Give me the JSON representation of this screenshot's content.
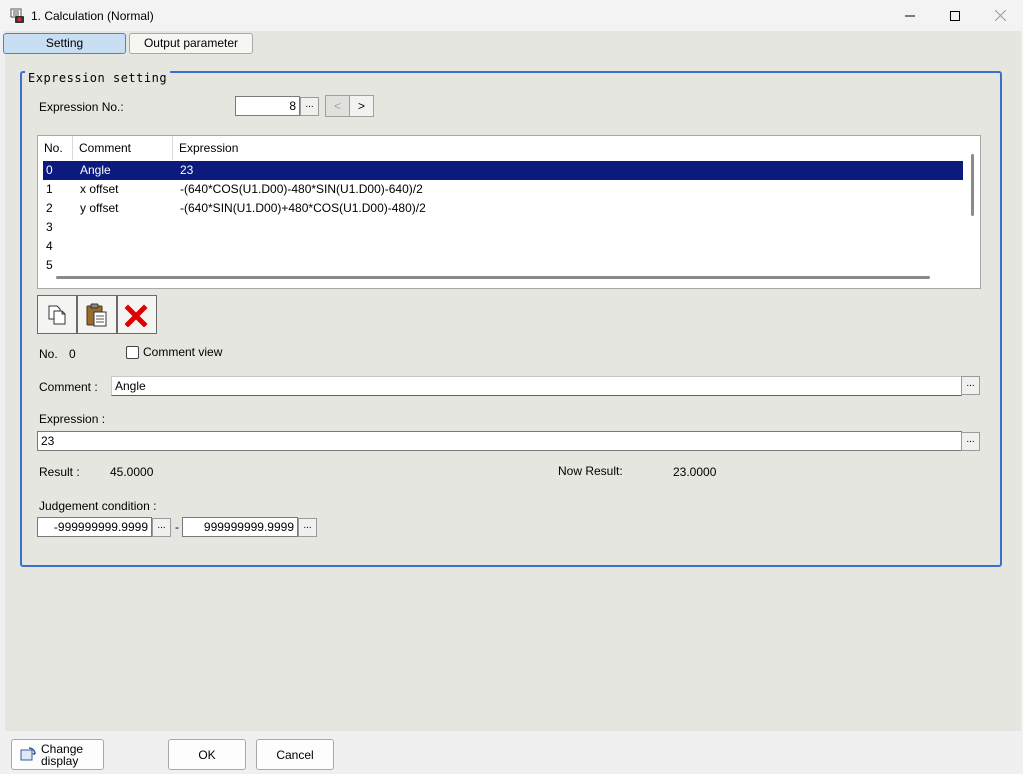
{
  "window": {
    "title": "1. Calculation (Normal)",
    "icon": "calculation-app-icon"
  },
  "tabs": [
    {
      "label": "Setting",
      "active": true
    },
    {
      "label": "Output parameter",
      "active": false
    }
  ],
  "group": {
    "legend": "Expression setting"
  },
  "expression_no": {
    "label": "Expression No.:",
    "value": "8",
    "ellipsis": "...",
    "prev": "<",
    "next": ">"
  },
  "table": {
    "headers": [
      "No.",
      "Comment",
      "Expression"
    ],
    "rows": [
      {
        "no": "0",
        "comment": "Angle",
        "expression": "23",
        "selected": true
      },
      {
        "no": "1",
        "comment": "x offset",
        "expression": "-(640*COS(U1.D00)-480*SIN(U1.D00)-640)/2"
      },
      {
        "no": "2",
        "comment": "y offset",
        "expression": "-(640*SIN(U1.D00)+480*COS(U1.D00)-480)/2"
      },
      {
        "no": "3",
        "comment": "",
        "expression": ""
      },
      {
        "no": "4",
        "comment": "",
        "expression": ""
      },
      {
        "no": "5",
        "comment": "",
        "expression": ""
      }
    ]
  },
  "toolbar": {
    "copy_icon": "copy-icon",
    "paste_icon": "paste-icon",
    "delete_icon": "delete-icon",
    "delete_color": "#e00000"
  },
  "detail": {
    "no_label": "No.",
    "no_value": "0",
    "comment_view_label": "Comment view",
    "comment_view_checked": false,
    "comment_label": "Comment :",
    "comment_value": "Angle",
    "expression_label": "Expression :",
    "expression_value": "23",
    "result_label": "Result :",
    "result_value": "45.0000",
    "now_result_label": "Now Result:",
    "now_result_value": "23.0000",
    "judgement_label": "Judgement condition :",
    "judgement_min": "-999999999.9999",
    "judgement_sep": "-",
    "judgement_max": "999999999.9999",
    "ellipsis": "..."
  },
  "footer": {
    "change_display_line1": "Change",
    "change_display_line2": "display",
    "ok": "OK",
    "cancel": "Cancel"
  },
  "colors": {
    "selection": "#0c1a7e",
    "group_border": "#3a70d2",
    "tab_active": "#c8def3"
  }
}
